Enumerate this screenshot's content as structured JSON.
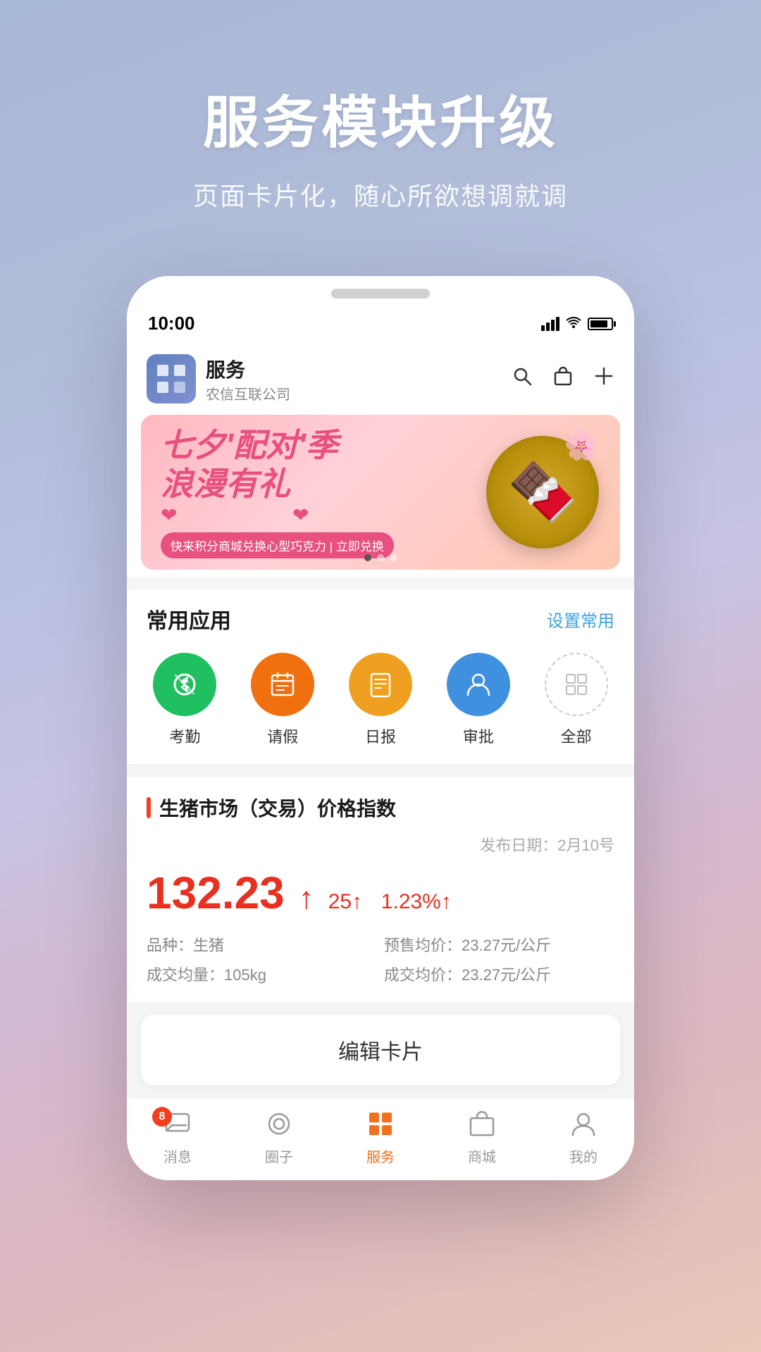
{
  "header": {
    "title": "服务模块升级",
    "subtitle": "页面卡片化，随心所欲想调就调"
  },
  "phone": {
    "status": {
      "time": "10:00",
      "time_arrow": "▶"
    },
    "app_header": {
      "name": "服务",
      "company": "农信互联公司",
      "search_icon": "search",
      "bag_icon": "bag",
      "plus_icon": "plus"
    },
    "banner": {
      "title_line1": "七夕'配对'季",
      "title_line2": "浪漫有礼",
      "cta": "快来积分商城兑换心型巧克力 | 立即兑换",
      "dots": 3,
      "active_dot": 0
    },
    "common_apps": {
      "section_title": "常用应用",
      "action_label": "设置常用",
      "apps": [
        {
          "label": "考勤",
          "icon": "bluetooth",
          "color": "green"
        },
        {
          "label": "请假",
          "icon": "calendar",
          "color": "orange"
        },
        {
          "label": "日报",
          "icon": "file",
          "color": "amber"
        },
        {
          "label": "审批",
          "icon": "person",
          "color": "blue"
        },
        {
          "label": "全部",
          "icon": "grid",
          "color": "outlined"
        }
      ]
    },
    "market_card": {
      "title": "生猪市场（交易）价格指数",
      "publish_date": "发布日期：2月10号",
      "price_main": "132.23",
      "price_up": "↑",
      "change_value": "25↑",
      "change_percent": "1.23%↑",
      "details": [
        {
          "label": "品种：",
          "value": "生猪"
        },
        {
          "label": "预售均价：",
          "value": "23.27元/公斤"
        },
        {
          "label": "成交均量：",
          "value": "105kg"
        },
        {
          "label": "成交均价：",
          "value": "23.27元/公斤"
        }
      ]
    },
    "edit_card": {
      "label": "编辑卡片"
    },
    "bottom_nav": {
      "items": [
        {
          "label": "消息",
          "icon": "chat",
          "badge": "8",
          "active": false
        },
        {
          "label": "圈子",
          "icon": "circle",
          "badge": null,
          "active": false
        },
        {
          "label": "服务",
          "icon": "apps",
          "badge": null,
          "active": true
        },
        {
          "label": "商城",
          "icon": "shop",
          "badge": null,
          "active": false
        },
        {
          "label": "我的",
          "icon": "person",
          "badge": null,
          "active": false
        }
      ]
    }
  }
}
